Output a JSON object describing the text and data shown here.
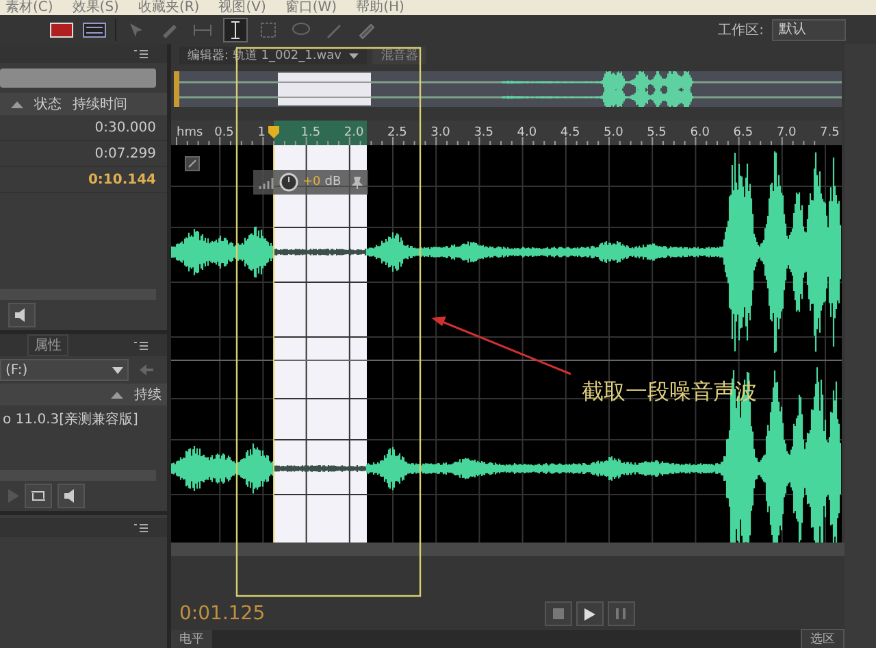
{
  "menu": [
    "素材(C)",
    "效果(S)",
    "收藏夹(R)",
    "视图(V)",
    "窗口(W)",
    "帮助(H)"
  ],
  "toolbar": {
    "tools": [
      {
        "kind": "move",
        "selected": false
      },
      {
        "kind": "razor",
        "selected": false
      },
      {
        "kind": "slip",
        "selected": false
      },
      {
        "kind": "time",
        "selected": true
      },
      {
        "kind": "marquee",
        "selected": false
      },
      {
        "kind": "lasso",
        "selected": false
      },
      {
        "kind": "brush",
        "selected": false
      },
      {
        "kind": "heal",
        "selected": false
      }
    ]
  },
  "workspace": {
    "label": "工作区:",
    "value": "默认"
  },
  "files_panel": {
    "columns": [
      "状态",
      "持续时间"
    ],
    "rows": [
      {
        "duration": "0:30.000",
        "selected": false
      },
      {
        "duration": "0:07.299",
        "selected": false
      },
      {
        "duration": "0:10.144",
        "selected": true
      }
    ]
  },
  "media_panel": {
    "tab": "属性",
    "drive": "(F:)",
    "column": "持续",
    "items": [
      "o 11.0.3[亲测兼容版]"
    ]
  },
  "editor": {
    "tab": "编辑器: 轨道 1_002_1.wav",
    "mixer_tab": "混音器",
    "ruler": {
      "unit": "hms",
      "labels": [
        "0.5",
        "1",
        "1.5",
        "2.0",
        "2.5",
        "3.0",
        "3.5",
        "4.0",
        "4.5",
        "5.0",
        "5.5",
        "6.0",
        "6.5",
        "7.0",
        "7.5"
      ]
    },
    "hud": {
      "gain": "+0",
      "unit": "dB"
    },
    "time": "0:01.125",
    "transport": [
      {
        "kind": "stop"
      },
      {
        "kind": "play"
      },
      {
        "kind": "pause"
      }
    ]
  },
  "annotation": "截取一段噪音声波",
  "bottom": {
    "levels_tab": "电平",
    "selection_panel": "选区"
  }
}
